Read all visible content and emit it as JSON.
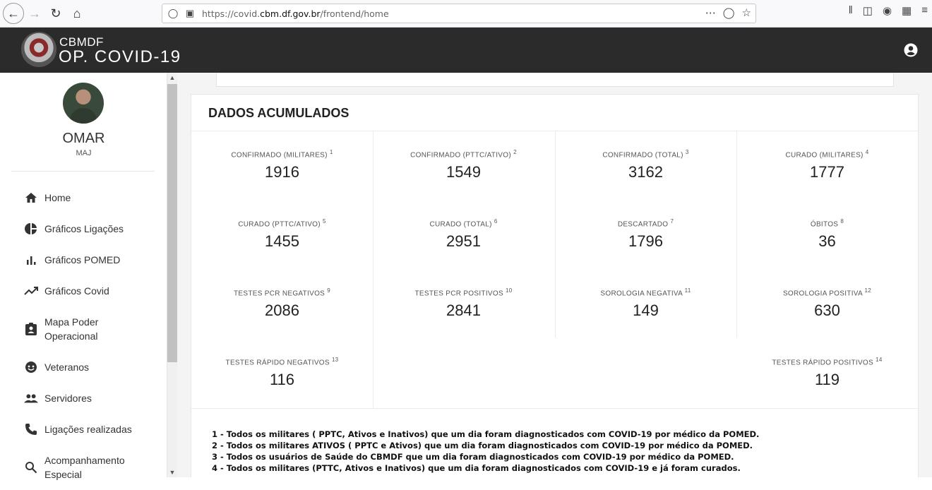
{
  "browser": {
    "url_prefix": "https://covid.",
    "url_domain": "cbm.df.gov.br",
    "url_suffix": "/frontend/home"
  },
  "header": {
    "brand_top": "CBMDF",
    "brand_main": "OP. COVID-19"
  },
  "user": {
    "name": "OMAR",
    "rank": "MAJ"
  },
  "sidebar": {
    "items": [
      {
        "label": "Home",
        "icon": "home-icon"
      },
      {
        "label": "Gráficos Ligações",
        "icon": "pie-chart-icon"
      },
      {
        "label": "Gráficos POMED",
        "icon": "bar-chart-icon"
      },
      {
        "label": "Gráficos Covid",
        "icon": "trending-up-icon"
      },
      {
        "label": "Mapa Poder Operacional",
        "icon": "badge-icon"
      },
      {
        "label": "Veteranos",
        "icon": "face-icon"
      },
      {
        "label": "Servidores",
        "icon": "people-icon"
      },
      {
        "label": "Ligações realizadas",
        "icon": "phone-icon"
      },
      {
        "label": "Acompanhamento Especial",
        "icon": "search-icon"
      }
    ]
  },
  "card": {
    "title": "DADOS ACUMULADOS",
    "stats": [
      {
        "label": "CONFIRMADO (MILITARES)",
        "ref": "1",
        "value": "1916"
      },
      {
        "label": "CONFIRMADO (PTTC/ATIVO)",
        "ref": "2",
        "value": "1549"
      },
      {
        "label": "CONFIRMADO (TOTAL)",
        "ref": "3",
        "value": "3162"
      },
      {
        "label": "CURADO (MILITARES)",
        "ref": "4",
        "value": "1777"
      },
      {
        "label": "CURADO (PTTC/ATIVO)",
        "ref": "5",
        "value": "1455"
      },
      {
        "label": "CURADO (TOTAL)",
        "ref": "6",
        "value": "2951"
      },
      {
        "label": "DESCARTADO",
        "ref": "7",
        "value": "1796"
      },
      {
        "label": "ÓBITOS",
        "ref": "8",
        "value": "36"
      },
      {
        "label": "TESTES PCR NEGATIVOS",
        "ref": "9",
        "value": "2086"
      },
      {
        "label": "TESTES PCR POSITIVOS",
        "ref": "10",
        "value": "2841"
      },
      {
        "label": "SOROLOGIA NEGATIVA",
        "ref": "11",
        "value": "149"
      },
      {
        "label": "SOROLOGIA POSITIVA",
        "ref": "12",
        "value": "630"
      },
      {
        "label": "TESTES RÁPIDO NEGATIVOS",
        "ref": "13",
        "value": "116"
      },
      {
        "label": "TESTES RÁPIDO POSITIVOS",
        "ref": "14",
        "value": "119"
      }
    ],
    "notes": [
      "1 - Todos os militares ( PPTC, Ativos e Inativos) que um dia foram diagnosticados com COVID-19 por médico da POMED.",
      "2 - Todos os militares ATIVOS ( PPTC e Ativos) que um dia foram diagnosticados com COVID-19 por médico da POMED.",
      "3 - Todos os usuários de Saúde do CBMDF que um dia foram diagnosticados com COVID-19 por médico da POMED.",
      "4 - Todos os militares (PTTC, Ativos e Inativos) que um dia foram diagnosticados com COVID-19 e já foram curados."
    ]
  }
}
